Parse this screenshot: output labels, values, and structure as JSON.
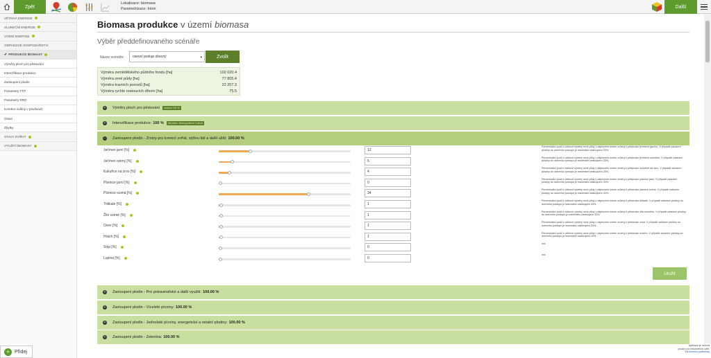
{
  "topbar": {
    "back_label": "Zpět",
    "next_label": "Další",
    "location_label": "Lokalizace: biomasa",
    "param_label": "Parametrizace: biom"
  },
  "sidebar": {
    "items": [
      {
        "label": "Větrná energie",
        "type": "cat",
        "dot": true
      },
      {
        "label": "Sluneční energie",
        "type": "cat",
        "dot": true
      },
      {
        "label": "Vodní energie",
        "type": "cat",
        "dot": true
      },
      {
        "label": "Odpadové hospodářství",
        "type": "cat",
        "dot": false
      },
      {
        "label": "Produkce biomasy",
        "type": "cat-active",
        "dot": true
      },
      {
        "label": "Výměry ploch pro pěstování",
        "type": "sub"
      },
      {
        "label": "Intenzifikace produkce",
        "type": "sub"
      },
      {
        "label": "Zastoupení plodin",
        "type": "sub"
      },
      {
        "label": "Parametry TTP",
        "type": "sub"
      },
      {
        "label": "Parametry RRD",
        "type": "sub"
      },
      {
        "label": "Korekce sušiny v plodinách",
        "type": "sub"
      },
      {
        "label": "Osiva",
        "type": "sub"
      },
      {
        "label": "Zbytky",
        "type": "sub"
      },
      {
        "label": "Stavy zvířat",
        "type": "cat",
        "dot": true
      },
      {
        "label": "Využití biomasy",
        "type": "cat",
        "dot": true
      }
    ],
    "add_label": "Přidej"
  },
  "page": {
    "title_bold": "Biomasa produkce",
    "title_mid": "v území",
    "title_italic": "biomasa",
    "subtitle": "Výběr předdefinovaného scénáře",
    "scenario_label": "Název scénáře:",
    "scenario_value": "osevní postup obecný",
    "choose_label": "Zvolit",
    "save_label": "Uložit"
  },
  "info": [
    {
      "label": "Výměra zemědělského půdního fondu [ha]",
      "value": "102 020.4"
    },
    {
      "label": "Výměra orné půdy [ha]",
      "value": "77 805.4"
    },
    {
      "label": "Výměra travních porostů [ha]",
      "value": "22 207.3"
    },
    {
      "label": "Výměra rychle rostoucích dřevin [ha]",
      "value": "75.5"
    }
  ],
  "accordions_top": [
    {
      "label": "Výměry ploch pro pěstování",
      "value": "",
      "badge": "zadáno 100 %"
    },
    {
      "label": "Intenzifikace produkce:",
      "value": "100 %",
      "badge": "dle plánu obhospodaření hodnot"
    },
    {
      "label": "Zastoupení plodin - Zrniny pro krmení zvířat, výživu lidí a další užití:",
      "value": "100.00 %",
      "badge": ""
    }
  ],
  "crops": [
    {
      "label": "Ječmen jarní [%]",
      "value": "12",
      "fraction": 0.12,
      "desc": "Percentuální podíl z celkové výměry orné půdy v zájmovém území určený k pěstování ječmene jarního. V případě zařazení plodiny do osevního postupu je maximální zastoupení 33%."
    },
    {
      "label": "Ječmen ozimý [%]",
      "value": "5",
      "fraction": 0.05,
      "desc": "Percentuální podíl z celkové výměry orné půdy v zájmovém území určený k pěstování ječmene ozimého. V případě zařazení plodiny do osevního postupu je maximální zastoupení 33%."
    },
    {
      "label": "Kukuřice na zrno [%]",
      "value": "4",
      "fraction": 0.04,
      "desc": "Percentuální podíl z celkové výměry orné půdy v zájmovém území určený k pěstování kukuřice na zrno. V případě zařazení plodiny do osevního postupu je maximální zastoupení 25%."
    },
    {
      "label": "Pšenice jarní [%]",
      "value": "0",
      "fraction": 0.0,
      "desc": "Percentuální podíl z celkové výměry orné půdy v zájmovém území určený k pěstování pšenice jarní. V případě zařazení plodiny do osevního postupu je maximální zastoupení 33%."
    },
    {
      "label": "Pšenice ozimá [%]",
      "value": "34",
      "fraction": 0.34,
      "desc": "Percentuální podíl z celkové výměry orné půdy v zájmovém území určený k pěstování pšenice ozimé. V případě zařazení plodiny do osevního postupu je maximální zastoupení 33%."
    },
    {
      "label": "Tritikale [%]",
      "value": "1",
      "fraction": 0.01,
      "desc": "Percentuální podíl z celkové výměry orné půdy v zájmovém území určený k pěstování tritikale. V případě zařazení plodiny do osevního postupu je maximální zastoupení 33%."
    },
    {
      "label": "Žito ozimé [%]",
      "value": "1",
      "fraction": 0.01,
      "desc": "Percentuální podíl z celkové výměry orné půdy v zájmovém území určený k pěstování žita ozimého. V případě zařazení plodiny do osevního postupu je maximální zastoupení 33%."
    },
    {
      "label": "Oves [%]",
      "value": "1",
      "fraction": 0.01,
      "desc": "Percentuální podíl z celkové výměry orné půdy v zájmovém území určený k pěstování ovsa. V případě zařazení plodiny do osevního postupu je maximální zastoupení 33%."
    },
    {
      "label": "Hrách [%]",
      "value": "1",
      "fraction": 0.01,
      "desc": "Percentuální podíl z celkové výměry orné půdy v zájmovém území určený k pěstování hrachu. V případě zařazení plodiny do osevního postupu je maximální zastoupení 25%."
    },
    {
      "label": "Sója [%]",
      "value": "0",
      "fraction": 0.0,
      "desc": "xxx"
    },
    {
      "label": "Lupina [%]",
      "value": "0",
      "fraction": 0.0,
      "desc": "xxx"
    }
  ],
  "accordions_bottom": [
    {
      "label": "Zastoupení plodin - Pro potravinářské a další využití:",
      "value": "100.00 %"
    },
    {
      "label": "Zastoupení plodin - Víceleté pícniny:",
      "value": "100.00 %"
    },
    {
      "label": "Zastoupení plodin - Jednoleté pícniny, energetické a ostatní plodiny:",
      "value": "100.00 %"
    },
    {
      "label": "Zastoupení plodin - Zelenina:",
      "value": "100.00 %"
    }
  ],
  "footer": {
    "line1": "Aplikace je určena",
    "line2": "pouze pro nekomerční užití.",
    "link": "Viz licenční podmínky"
  },
  "colors": {
    "accent": "#5d9b2c",
    "accordion": "#c8dfa0",
    "slider_fill": "#f0a94e"
  }
}
